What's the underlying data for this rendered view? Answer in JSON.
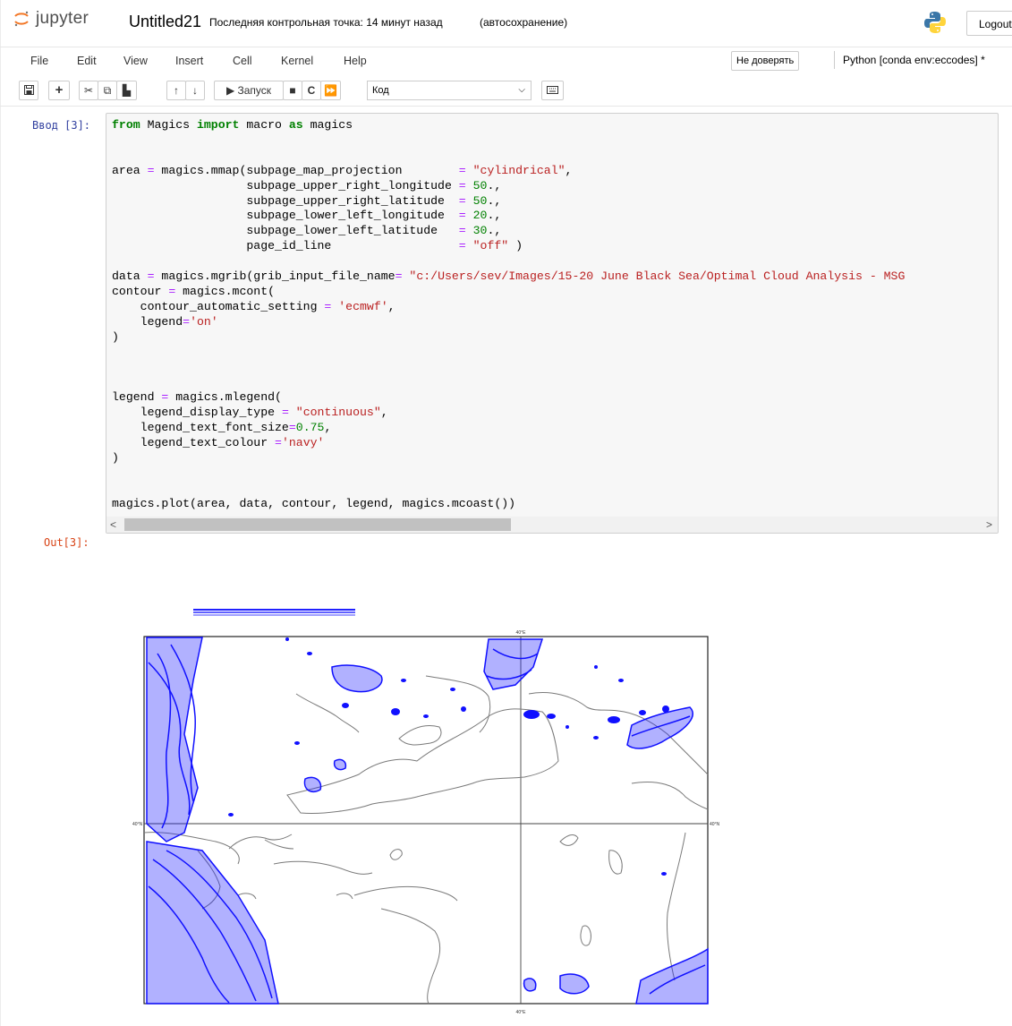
{
  "header": {
    "logo_text": "jupyter",
    "notebook_name": "Untitled21",
    "checkpoint": "Последняя контрольная точка: 14 минут назад",
    "autosave": "(автосохранение)",
    "logout_label": "Logout"
  },
  "menu": {
    "items": [
      "File",
      "Edit",
      "View",
      "Insert",
      "Cell",
      "Kernel",
      "Help"
    ],
    "trust_label": "Не доверять",
    "kernel_label": "Python [conda env:eccodes] *"
  },
  "toolbar": {
    "run_label": "▶ Запуск",
    "cell_type": "Код"
  },
  "cell": {
    "in_prompt": "Ввод [3]:",
    "out_prompt": "Out[3]:",
    "code_lines": [
      "from Magics import macro as magics",
      "",
      "",
      "area = magics.mmap(subpage_map_projection        = \"cylindrical\",",
      "                   subpage_upper_right_longitude = 50.,",
      "                   subpage_upper_right_latitude  = 50.,",
      "                   subpage_lower_left_longitude  = 20.,",
      "                   subpage_lower_left_latitude   = 30.,",
      "                   page_id_line                  = \"off\" )",
      "",
      "data = magics.mgrib(grib_input_file_name= \"c:/Users/sev/Images/15-20 June Black Sea/Optimal Cloud Analysis - MSG",
      "contour = magics.mcont(",
      "    contour_automatic_setting = 'ecmwf',",
      "    legend='on'",
      ")",
      "",
      "",
      "",
      "legend = magics.mlegend(",
      "    legend_display_type = \"continuous\",",
      "    legend_text_font_size=0.75,",
      "    legend_text_colour ='navy'",
      ")",
      "",
      "",
      "magics.plot(area, data, contour, legend, magics.mcoast())"
    ]
  },
  "map": {
    "lat_label": "40°N",
    "lon_label": "40°E",
    "coast_color": "#7a7a7a",
    "contour_color": "#1010ff"
  },
  "colors": {
    "in_prompt": "#303f9f",
    "out_prompt": "#d84315",
    "keyword": "#008000",
    "string": "#ba2121"
  }
}
